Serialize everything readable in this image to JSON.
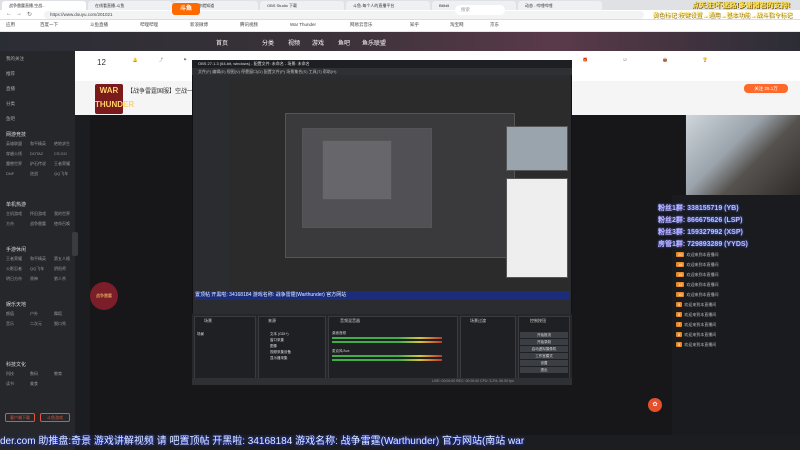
{
  "browser": {
    "tabs": [
      "战争雷霆直播,空战...",
      "在线看直播-斗鱼",
      "百度一下,你就知道",
      "OBS Studio 下载",
      "斗鱼-每个人的直播平台",
      "Bilibili",
      "动态 - 哔哩哔哩",
      "War Thunder - 2019..."
    ],
    "url": "https://www.douyu.com/201021",
    "bookmarks": [
      "应用",
      "百度一下",
      "斗鱼直播",
      "哔哩哔哩",
      "新浪微博",
      "腾讯视频",
      "War Thunder",
      "网易云音乐",
      "知乎",
      "淘宝网",
      "京东"
    ]
  },
  "notice": {
    "line1": "点关注!不迷路!多谢诸君的支持!",
    "line2": "黄色标记:按键设置→通用→基本功能→战斗指令标记"
  },
  "header": {
    "logo": "斗鱼",
    "nav": [
      "首页",
      "分类",
      "视频",
      "游戏",
      "鱼吧",
      "鱼乐联盟"
    ],
    "search_placeholder": "搜索"
  },
  "sidebar": {
    "top_items": [
      "我的关注",
      "推荐",
      "直播",
      "分类",
      "鱼吧"
    ],
    "section1": "网游竞技",
    "grid1": [
      "英雄联盟",
      "和平精英",
      "绝地求生",
      "穿越火线",
      "DOTA2",
      "CS:GO",
      "魔兽世界",
      "炉石传说",
      "王者荣耀",
      "DNF",
      "逆战",
      "QQ飞车"
    ],
    "section2": "单机热游",
    "grid2": [
      "主机游戏",
      "怀旧游戏",
      "我的世界",
      "方舟",
      "战争雷霆",
      "使命召唤"
    ],
    "section3": "手游休闲",
    "grid3": [
      "王者荣耀",
      "和平精英",
      "第五人格",
      "火影忍者",
      "QQ飞车",
      "阴阳师",
      "明日方舟",
      "原神",
      "狼人杀"
    ],
    "section4": "娱乐天地",
    "grid4": [
      "颜值",
      "户外",
      "舞蹈",
      "音乐",
      "二次元",
      "脱口秀"
    ],
    "section5": "科技文化",
    "grid5": [
      "科技",
      "数码",
      "教育",
      "读书",
      "美食"
    ],
    "btn1": "客户端下载",
    "btn2": "斗鱼游戏"
  },
  "room": {
    "number": "12",
    "avatar_text": "WAR THUNDER",
    "title": "【战争雷霆国服】空战一起来……",
    "follow": "关注 25.1万"
  },
  "obs": {
    "title": "OBS 27.1.3 (64-bit, windows) - 配置文件: 未命名 - 场景: 未命名",
    "menu": "文件(F)  编辑(E)  视图(V)  停靠窗口(D)  配置文件(P)  场景集合(S)  工具(T)  帮助(H)",
    "docks": [
      "场景",
      "来源",
      "音频混音器",
      "场景过渡",
      "控制按钮"
    ],
    "scene_item": "场景",
    "sources": [
      "文本 (GDI+)",
      "窗口采集",
      "图像",
      "视频采集设备",
      "显示器采集"
    ],
    "mixer": [
      "桌面音频",
      "麦克风/Aux"
    ],
    "controls": [
      "开始推流",
      "开始录制",
      "启动虚拟摄像机",
      "工作室模式",
      "设置",
      "退出"
    ],
    "status": "LIVE: 00:00:00   REC: 00:00:00   CPU: 3.2%, 60.00 fps"
  },
  "marquee": "der.com 助推盘:奇景 游戏讲解视频 请 吧置顶帖 开黑啦: 34168184 游戏名称: 战争雷霆(Warthunder) 官方网站(南站 war",
  "obs_marquee": "置顶帖 开黑啦: 34168184 游戏名称: 战争雷霆(Warthunder) 官方网站",
  "fans": [
    "粉丝1群: 338155719 (YB)",
    "粉丝2群: 866675626 (LSP)",
    "粉丝3群: 159327992 (XSP)",
    "房管1群: 729893289 (YYDS)"
  ],
  "chat": [
    "欢迎来到本直播间",
    "欢迎来到本直播间",
    "欢迎来到本直播间",
    "欢迎来到本直播间",
    "欢迎来到本直播间",
    "欢迎来到本直播间",
    "欢迎来到本直播间",
    "欢迎来到本直播间",
    "欢迎来到本直播间",
    "欢迎来到本直播间",
    "欢迎来到本直播间",
    "欢迎来到本直播间"
  ],
  "streamer_badge": "战争雷霆",
  "gift_icon": "gift-icon"
}
